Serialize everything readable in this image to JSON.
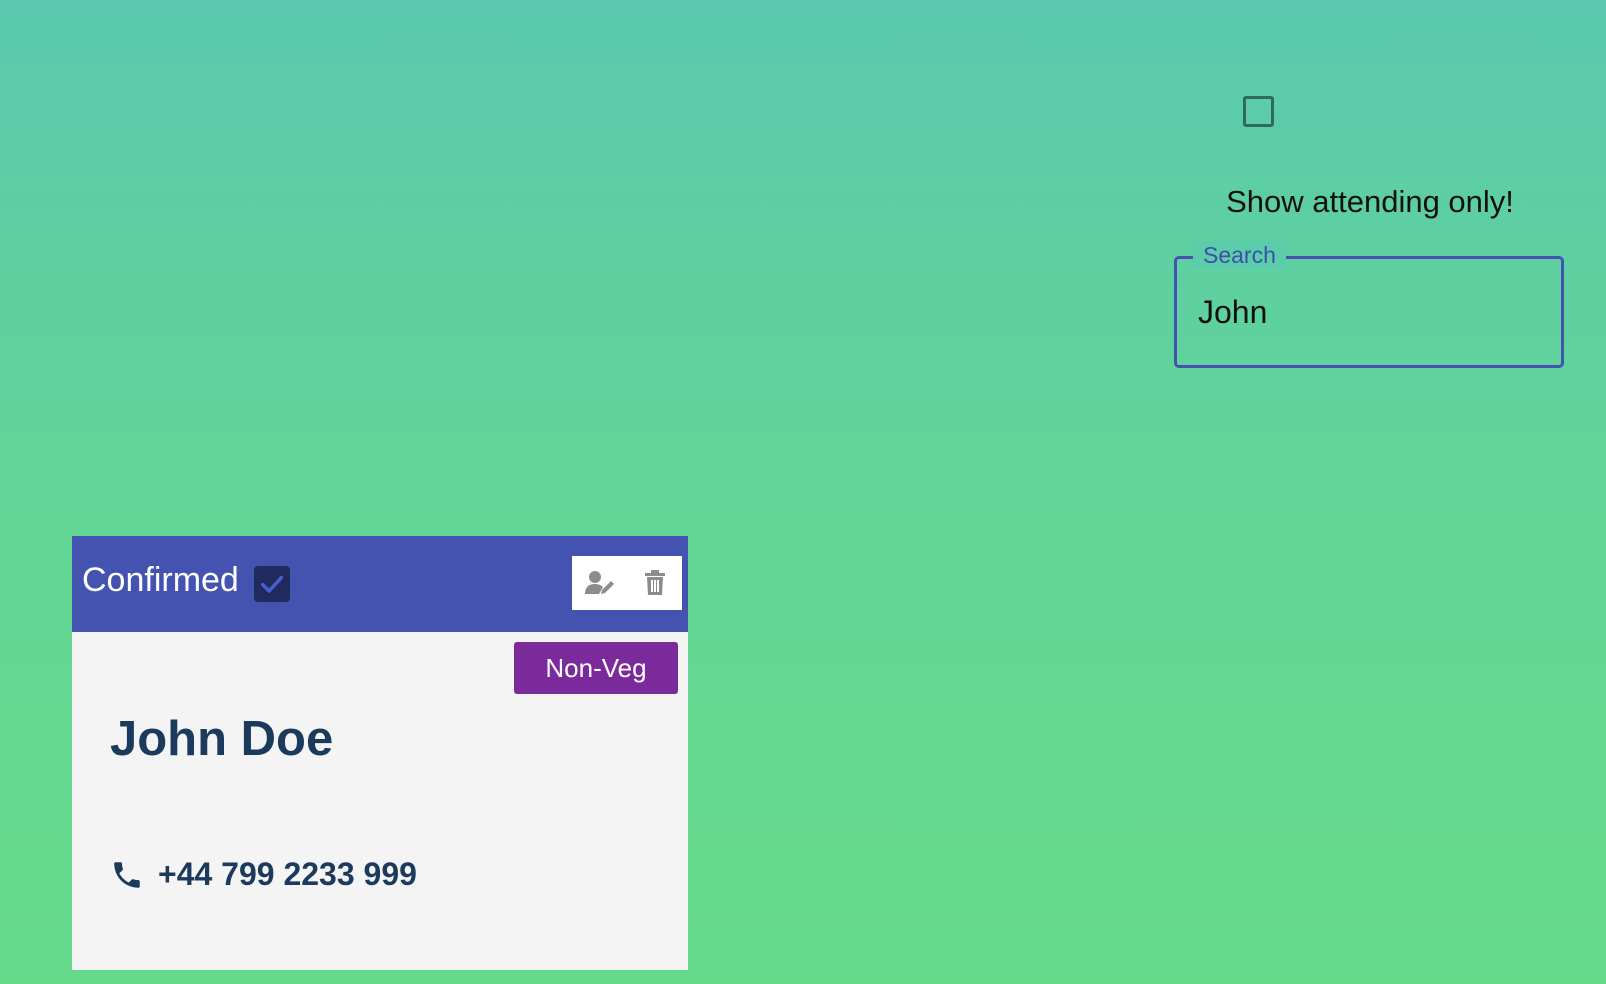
{
  "filter": {
    "checked": false,
    "label": "Show attending only!"
  },
  "search": {
    "label": "Search",
    "value": "John",
    "accent_color": "#4553b0"
  },
  "card": {
    "status_label": "Confirmed",
    "confirmed": true,
    "header_color": "#4453b0",
    "actions": [
      {
        "icon": "edit-user-icon"
      },
      {
        "icon": "trash-icon"
      }
    ],
    "diet_badge": "Non-Veg",
    "badge_color": "#7b2a9c",
    "name": "John Doe",
    "phone_icon": "phone-icon",
    "phone": "+44 799 2233 999"
  }
}
